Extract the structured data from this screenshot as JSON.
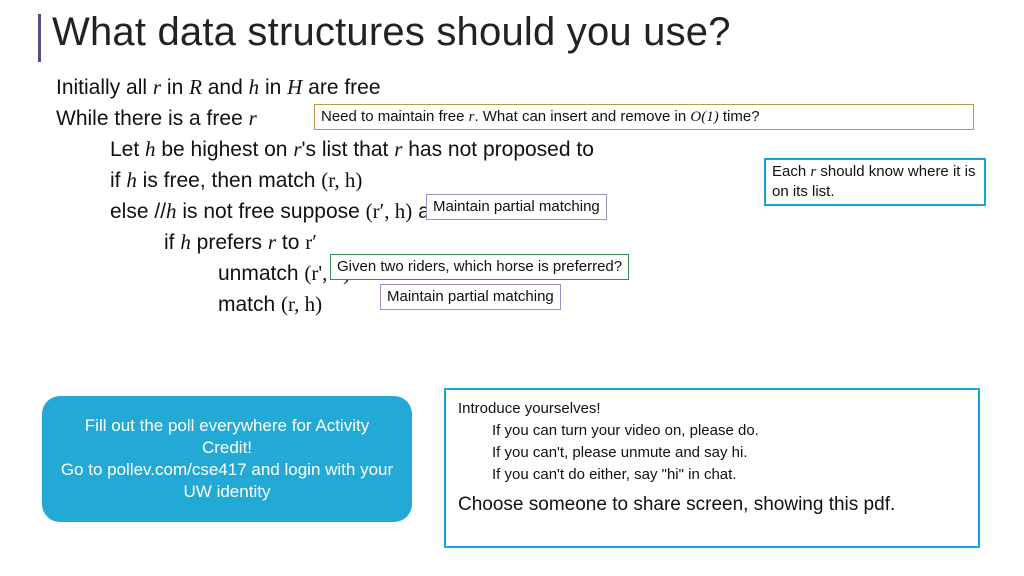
{
  "title": "What data structures should you use?",
  "algo": {
    "l1a": "Initially all ",
    "l1b": " in ",
    "l1c": " and ",
    "l1d": " in ",
    "l1e": " are free",
    "l2a": "While there is a free ",
    "l3a": "Let ",
    "l3b": " be highest on ",
    "l3c": "'s list that ",
    "l3d": " has not proposed to",
    "l4a": "if ",
    "l4b": " is free, then match ",
    "l5a": "else //",
    "l5b": " is not free suppose ",
    "l5c": " are matched",
    "l6a": "if ",
    "l6b": " prefers ",
    "l6c": " to ",
    "l7a": "unmatch ",
    "l8a": "match ",
    "sym": {
      "r": "r",
      "R": "R",
      "h": "h",
      "H": "H",
      "rh": "(r, h)",
      "rph": "(r′, h)",
      "rp": "r′",
      "rcommah": "(r', h)"
    }
  },
  "notes": {
    "gold_a": "Need to maintain free ",
    "gold_b": ". What can insert and remove in ",
    "gold_c": " time?",
    "O1": "O(1)",
    "cyan1a": "Each ",
    "cyan1b": " should know where it is on its list.",
    "purple": "Maintain partial matching",
    "green": "Given two riders, which horse is preferred?"
  },
  "poll": {
    "l1": "Fill out the poll everywhere for Activity Credit!",
    "l2": "Go to pollev.com/cse417 and login with your UW identity"
  },
  "intro": {
    "l1": "Introduce yourselves!",
    "l2": "If you can turn your video on, please do.",
    "l3": "If you can't, please unmute and say hi.",
    "l4": "If you can't do either, say \"hi\" in chat.",
    "l5": "Choose someone to share screen, showing this pdf."
  }
}
